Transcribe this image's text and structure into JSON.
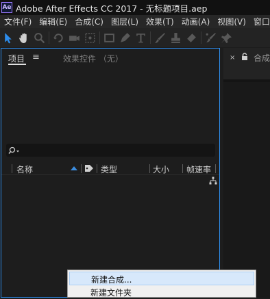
{
  "window": {
    "app_icon_label": "Ae",
    "title": "Adobe After Effects CC 2017 - 无标题项目.aep"
  },
  "menubar": {
    "items": [
      "文件(F)",
      "编辑(E)",
      "合成(C)",
      "图层(L)",
      "效果(T)",
      "动画(A)",
      "视图(V)",
      "窗口"
    ]
  },
  "toolbar": {
    "tools": [
      "selection-tool-icon",
      "hand-tool-icon",
      "zoom-tool-icon",
      "rotation-tool-icon",
      "camera-tool-icon",
      "pan-behind-tool-icon",
      "rectangle-tool-icon",
      "pen-tool-icon",
      "type-tool-icon",
      "brush-tool-icon",
      "clone-stamp-tool-icon",
      "eraser-tool-icon",
      "roto-brush-tool-icon",
      "puppet-pin-tool-icon"
    ],
    "active_color": "#2d8ceb"
  },
  "project_panel": {
    "tab_project": "项目",
    "tab_menu": "≡",
    "tab_effects": "效果控件 （无）",
    "search_placeholder": "",
    "columns": {
      "name": "名称",
      "type": "类型",
      "size": "大小",
      "frame_rate": "帧速率"
    }
  },
  "right_panel": {
    "close": "×",
    "tab_label": "合成"
  },
  "context_menu": {
    "items": [
      "新建合成...",
      "新建文件夹"
    ]
  }
}
